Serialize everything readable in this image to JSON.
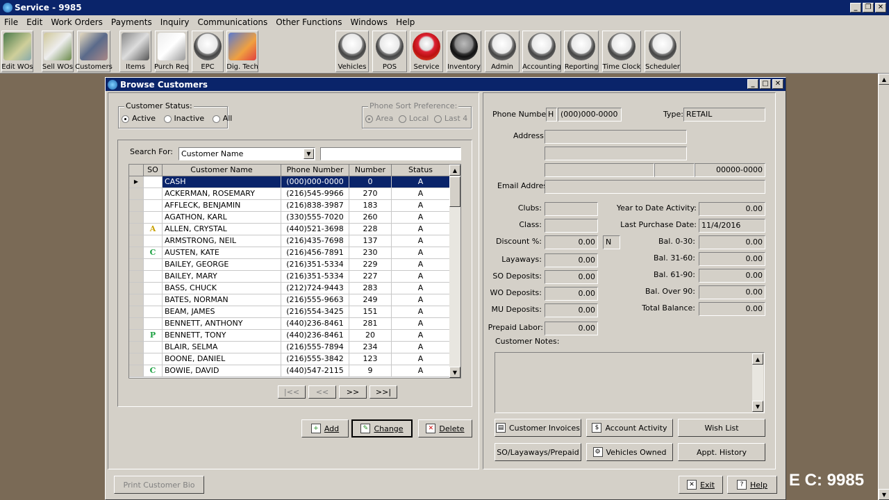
{
  "app": {
    "title": "Service - 9985",
    "watermark": "E C: 9985"
  },
  "menu": [
    "File",
    "Edit",
    "Work Orders",
    "Payments",
    "Inquiry",
    "Communications",
    "Other Functions",
    "Windows",
    "Help"
  ],
  "toolbar_left": [
    {
      "label": "Edit WOs",
      "icon": "edit-wos-icon"
    },
    {
      "label": "Sell WOs",
      "icon": "sell-wos-icon"
    },
    {
      "label": "Customers",
      "icon": "customers-icon"
    },
    {
      "label": "Items",
      "icon": "items-icon"
    },
    {
      "label": "Purch Req",
      "icon": "purchase-req-icon"
    },
    {
      "label": "EPC",
      "icon": "epc-icon"
    },
    {
      "label": "Dig. Tech",
      "icon": "dig-tech-icon"
    }
  ],
  "toolbar_right": [
    {
      "label": "Vehicles",
      "icon": "vehicles-icon"
    },
    {
      "label": "POS",
      "icon": "pos-icon"
    },
    {
      "label": "Service",
      "icon": "service-icon"
    },
    {
      "label": "Inventory",
      "icon": "inventory-icon"
    },
    {
      "label": "Admin",
      "icon": "admin-icon"
    },
    {
      "label": "Accounting",
      "icon": "accounting-icon"
    },
    {
      "label": "Reporting",
      "icon": "reporting-icon"
    },
    {
      "label": "Time Clock",
      "icon": "time-clock-icon"
    },
    {
      "label": "Scheduler",
      "icon": "scheduler-icon"
    }
  ],
  "window": {
    "title": "Browse Customers"
  },
  "status": {
    "label": "Customer Status:",
    "active": "Active",
    "inactive": "Inactive",
    "all": "All",
    "selected": "Active"
  },
  "phone_sort": {
    "label": "Phone Sort Preference:",
    "area": "Area",
    "local": "Local",
    "last4": "Last 4",
    "selected": "Area"
  },
  "search": {
    "label": "Search For:",
    "field": "Customer Name",
    "value": ""
  },
  "grid": {
    "headers": [
      "SO",
      "Customer Name",
      "Phone Number",
      "Number",
      "Status"
    ],
    "rows": [
      {
        "so": "",
        "name": "CASH",
        "phone": "(000)000-0000",
        "number": "0",
        "status": "A"
      },
      {
        "so": "",
        "name": "ACKERMAN, ROSEMARY",
        "phone": "(216)545-9966",
        "number": "270",
        "status": "A"
      },
      {
        "so": "",
        "name": "AFFLECK, BENJAMIN",
        "phone": "(216)838-3987",
        "number": "183",
        "status": "A"
      },
      {
        "so": "",
        "name": "AGATHON, KARL",
        "phone": "(330)555-7020",
        "number": "260",
        "status": "A"
      },
      {
        "so": "A",
        "name": "ALLEN, CRYSTAL",
        "phone": "(440)521-3698",
        "number": "228",
        "status": "A"
      },
      {
        "so": "",
        "name": "ARMSTRONG, NEIL",
        "phone": "(216)435-7698",
        "number": "137",
        "status": "A"
      },
      {
        "so": "C",
        "name": "AUSTEN, KATE",
        "phone": "(216)456-7891",
        "number": "230",
        "status": "A"
      },
      {
        "so": "",
        "name": "BAILEY, GEORGE",
        "phone": "(216)351-5334",
        "number": "229",
        "status": "A"
      },
      {
        "so": "",
        "name": "BAILEY, MARY",
        "phone": "(216)351-5334",
        "number": "227",
        "status": "A"
      },
      {
        "so": "",
        "name": "BASS, CHUCK",
        "phone": "(212)724-9443",
        "number": "283",
        "status": "A"
      },
      {
        "so": "",
        "name": "BATES, NORMAN",
        "phone": "(216)555-9663",
        "number": "249",
        "status": "A"
      },
      {
        "so": "",
        "name": "BEAM, JAMES",
        "phone": "(216)554-3425",
        "number": "151",
        "status": "A"
      },
      {
        "so": "",
        "name": "BENNETT, ANTHONY",
        "phone": "(440)236-8461",
        "number": "281",
        "status": "A"
      },
      {
        "so": "P",
        "name": "BENNETT, TONY",
        "phone": "(440)236-8461",
        "number": "20",
        "status": "A"
      },
      {
        "so": "",
        "name": "BLAIR, SELMA",
        "phone": "(216)555-7894",
        "number": "234",
        "status": "A"
      },
      {
        "so": "",
        "name": "BOONE, DANIEL",
        "phone": "(216)555-3842",
        "number": "123",
        "status": "A"
      },
      {
        "so": "C",
        "name": "BOWIE, DAVID",
        "phone": "(440)547-2115",
        "number": "9",
        "status": "A"
      }
    ]
  },
  "nav": {
    "first": "|<<",
    "prev": "<<",
    "next": ">>",
    "last": ">>|"
  },
  "buttons": {
    "add": "Add",
    "change": "Change",
    "delete": "Delete",
    "print_bio": "Print Customer Bio",
    "exit": "Exit",
    "help": "Help"
  },
  "detail": {
    "phone_label": "Phone Number:",
    "phone_type": "H",
    "phone": "(000)000-0000",
    "type_label": "Type:",
    "type": "RETAIL",
    "address_label": "Address:",
    "zip": "00000-0000",
    "email_label": "Email Address:",
    "clubs_label": "Clubs:",
    "class_label": "Class:",
    "discount_label": "Discount %:",
    "discount": "0.00",
    "discount_flag": "N",
    "layaways_label": "Layaways:",
    "layaways": "0.00",
    "so_dep_label": "SO Deposits:",
    "so_dep": "0.00",
    "wo_dep_label": "WO Deposits:",
    "wo_dep": "0.00",
    "mu_dep_label": "MU Deposits:",
    "mu_dep": "0.00",
    "prepaid_label": "Prepaid Labor:",
    "prepaid": "0.00",
    "ytd_label": "Year to Date Activity:",
    "ytd": "0.00",
    "last_purchase_label": "Last Purchase Date:",
    "last_purchase": "11/4/2016",
    "bal030_label": "Bal. 0-30:",
    "bal030": "0.00",
    "bal3160_label": "Bal. 31-60:",
    "bal3160": "0.00",
    "bal6190_label": "Bal. 61-90:",
    "bal6190": "0.00",
    "balover_label": "Bal. Over 90:",
    "balover": "0.00",
    "total_label": "Total Balance:",
    "total": "0.00",
    "notes_label": "Customer Notes:"
  },
  "actions": {
    "invoices": "Customer Invoices",
    "activity": "Account Activity",
    "wishlist": "Wish List",
    "so_lay": "SO/Layaways/Prepaid",
    "vehicles": "Vehicles Owned",
    "appt": "Appt. History"
  },
  "colors": {
    "titlebar": "#0a246a",
    "face": "#d4d0c8",
    "desktop": "#7a6a56",
    "selected_row": "#0a246a"
  }
}
